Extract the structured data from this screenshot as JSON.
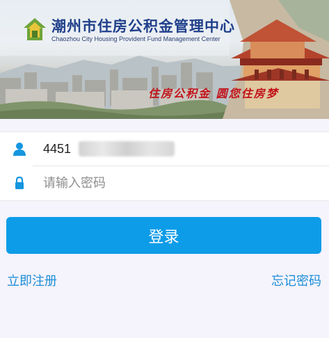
{
  "banner": {
    "title_cn": "潮州市住房公积金管理中心",
    "title_en": "Chaozhou City Housing Provident Fund Management Center",
    "slogan": "住房公积金  圆您住房梦"
  },
  "form": {
    "account_value": "4451",
    "account_icon": "user-icon",
    "password_placeholder": "请输入密码",
    "password_icon": "lock-icon"
  },
  "actions": {
    "login_label": "登录",
    "register_label": "立即注册",
    "forgot_label": "忘记密码"
  },
  "colors": {
    "accent": "#0d9ce8",
    "link": "#1c8ed8",
    "title": "#1f3f8a",
    "slogan": "#c2131a"
  }
}
